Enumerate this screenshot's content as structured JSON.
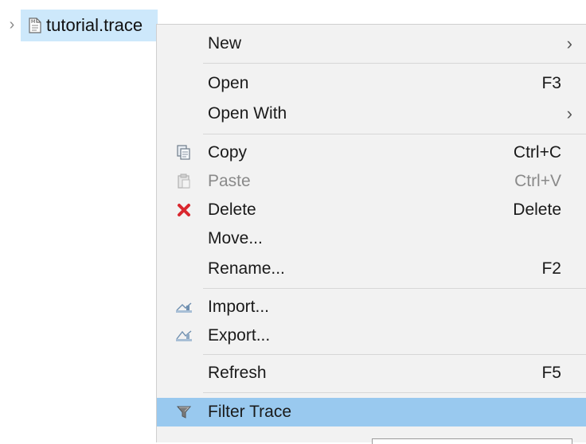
{
  "tree": {
    "expand_glyph": "›",
    "item_label": "tutorial.trace",
    "item_icon": "trace-file-icon"
  },
  "menu": {
    "items": [
      {
        "label": "New",
        "shortcut": "",
        "submenu_glyph": "›",
        "icon": ""
      },
      {
        "label": "Open",
        "shortcut": "F3",
        "icon": ""
      },
      {
        "label": "Open With",
        "shortcut": "",
        "submenu_glyph": "›",
        "icon": ""
      },
      {
        "label": "Copy",
        "shortcut": "Ctrl+C",
        "icon": "copy-icon"
      },
      {
        "label": "Paste",
        "shortcut": "Ctrl+V",
        "icon": "paste-icon",
        "disabled": true
      },
      {
        "label": "Delete",
        "shortcut": "Delete",
        "icon": "delete-icon"
      },
      {
        "label": "Move...",
        "shortcut": "",
        "icon": ""
      },
      {
        "label": "Rename...",
        "shortcut": "F2",
        "icon": ""
      },
      {
        "label": "Import...",
        "shortcut": "",
        "icon": "import-icon"
      },
      {
        "label": "Export...",
        "shortcut": "",
        "icon": "export-icon"
      },
      {
        "label": "Refresh",
        "shortcut": "F5",
        "icon": ""
      },
      {
        "label": "Filter Trace",
        "shortcut": "",
        "icon": "filter-icon",
        "selected": true
      }
    ]
  },
  "colors": {
    "selection": "#99c9ef",
    "tree_selection": "#cde8fb",
    "menu_background": "#f2f2f2",
    "delete_red": "#d9282f"
  }
}
